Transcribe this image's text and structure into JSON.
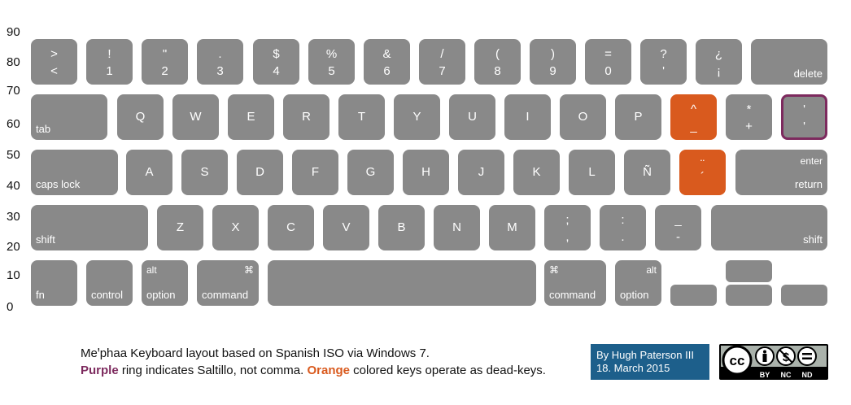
{
  "axis": {
    "ticks": [
      "90",
      "80",
      "70",
      "60",
      "50",
      "40",
      "30",
      "20",
      "10",
      "0"
    ]
  },
  "row1": [
    {
      "top": ">",
      "bottom": "<"
    },
    {
      "top": "!",
      "bottom": "1"
    },
    {
      "top": "\"",
      "bottom": "2"
    },
    {
      "top": ".",
      "bottom": "3"
    },
    {
      "top": "$",
      "bottom": "4"
    },
    {
      "top": "%",
      "bottom": "5"
    },
    {
      "top": "&",
      "bottom": "6"
    },
    {
      "top": "/",
      "bottom": "7"
    },
    {
      "top": "(",
      "bottom": "8"
    },
    {
      "top": ")",
      "bottom": "9"
    },
    {
      "top": "=",
      "bottom": "0"
    },
    {
      "top": "?",
      "bottom": "'"
    },
    {
      "top": "¿",
      "bottom": "¡"
    }
  ],
  "delete_label": "delete",
  "tab_label": "tab",
  "row2": [
    "Q",
    "W",
    "E",
    "R",
    "T",
    "Y",
    "U",
    "I",
    "O",
    "P"
  ],
  "row2_dead": {
    "top": "^",
    "bottom": "_"
  },
  "row2_plus": {
    "top": "*",
    "bottom": "+"
  },
  "row2_saltillo": {
    "top": "'",
    "bottom": "'"
  },
  "caps_label": "caps lock",
  "row3": [
    "A",
    "S",
    "D",
    "F",
    "G",
    "H",
    "J",
    "K",
    "L",
    "Ñ"
  ],
  "row3_dead": {
    "top": "¨",
    "bottom": "´"
  },
  "enter_top": "enter",
  "enter_bottom": "return",
  "shift_left": "shift",
  "row4": [
    "Z",
    "X",
    "C",
    "V",
    "B",
    "N",
    "M"
  ],
  "row4_punct": [
    {
      "top": ";",
      "bottom": ","
    },
    {
      "top": ":",
      "bottom": "."
    },
    {
      "top": "_",
      "bottom": "-"
    }
  ],
  "shift_right": "shift",
  "bottom_row": {
    "fn": "fn",
    "control": "control",
    "option_alt": "alt",
    "option": "option",
    "command_symbol": "⌘",
    "command": "command"
  },
  "caption": {
    "line1": "Meꞌphaa Keyboard layout based on Spanish ISO via Windows 7.",
    "purple_word": "Purple",
    "line2_mid": " ring indicates Saltillo, not comma. ",
    "orange_word": "Orange",
    "line2_end": " colored keys operate as dead-keys."
  },
  "author": {
    "line1": "By Hugh Paterson III",
    "line2": "18. March 2015"
  },
  "license": {
    "badges": [
      "BY",
      "NC",
      "ND"
    ],
    "icons": [
      "cc-icon",
      "person-icon",
      "no-dollar-icon",
      "equals-icon"
    ]
  },
  "colors": {
    "key": "#898989",
    "dead_key": "#d95a1e",
    "saltillo_ring": "#7d2a5e",
    "author_bg": "#1d5f8b"
  }
}
